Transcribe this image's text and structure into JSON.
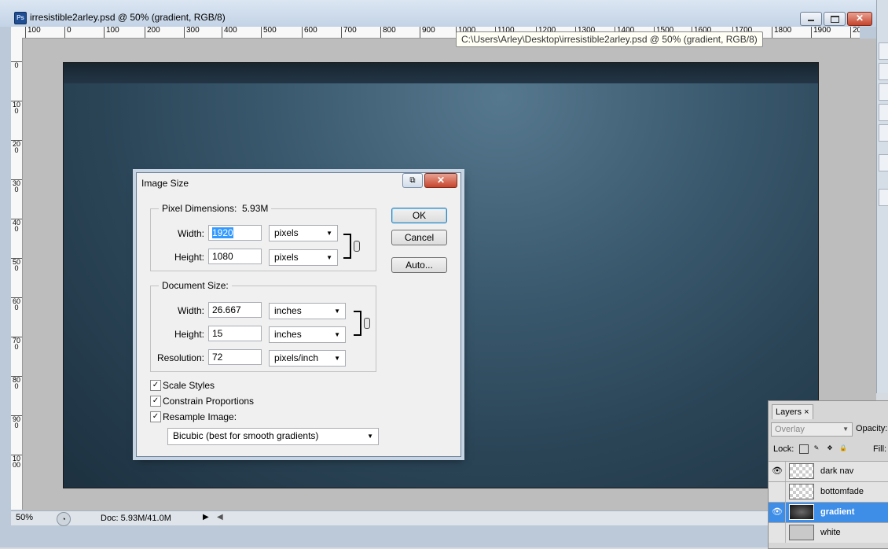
{
  "window": {
    "title": "irresistible2arley.psd @ 50% (gradient, RGB/8)",
    "app_icon_text": "Ps",
    "tooltip": "C:\\Users\\Arley\\Desktop\\irresistible2arley.psd @ 50% (gradient, RGB/8)",
    "close_glyph": "✕"
  },
  "rulers": {
    "horizontal": [
      "100",
      "0",
      "100",
      "200",
      "300",
      "400",
      "500",
      "600",
      "700",
      "800",
      "900",
      "1000",
      "1100",
      "1200",
      "1300",
      "1400",
      "1500",
      "1600",
      "1700",
      "1800",
      "1900",
      "20"
    ],
    "vertical": [
      "0",
      "100",
      "200",
      "300",
      "400",
      "500",
      "600",
      "700",
      "800",
      "900",
      "1000"
    ]
  },
  "status": {
    "zoom": "50%",
    "doc": "Doc: 5.93M/41.0M",
    "arrow": "▶",
    "scroll_left": "◀"
  },
  "dialog": {
    "title": "Image Size",
    "close_glyph": "✕",
    "extra_glyph": "⧉",
    "pixel_dimensions": {
      "legend": "Pixel Dimensions:",
      "size": "5.93M",
      "width_label": "Width:",
      "width_value": "1920",
      "width_unit": "pixels",
      "height_label": "Height:",
      "height_value": "1080",
      "height_unit": "pixels"
    },
    "document_size": {
      "legend": "Document Size:",
      "width_label": "Width:",
      "width_value": "26.667",
      "width_unit": "inches",
      "height_label": "Height:",
      "height_value": "15",
      "height_unit": "inches",
      "resolution_label": "Resolution:",
      "resolution_value": "72",
      "resolution_unit": "pixels/inch"
    },
    "buttons": {
      "ok": "OK",
      "cancel": "Cancel",
      "auto": "Auto..."
    },
    "checkboxes": [
      {
        "label": "Scale Styles",
        "checked": true
      },
      {
        "label": "Constrain Proportions",
        "checked": true
      },
      {
        "label": "Resample Image:",
        "checked": true
      }
    ],
    "check_glyph": "✓",
    "resample_method": "Bicubic (best for smooth gradients)",
    "select_arrow": "▼"
  },
  "layers_panel": {
    "tab": "Layers",
    "tab_close": "×",
    "blend_mode": "Overlay",
    "opacity_label": "Opacity:",
    "lock_label": "Lock:",
    "fill_label": "Fill:",
    "eye_glyph": "👁",
    "layers": [
      {
        "name": "dark nav",
        "visible": true,
        "active": false
      },
      {
        "name": "bottomfade",
        "visible": false,
        "active": false
      },
      {
        "name": "gradient",
        "visible": true,
        "active": true
      },
      {
        "name": "white",
        "visible": false,
        "active": false
      }
    ]
  },
  "colors": {
    "accent": "#3e8ee8",
    "selection": "#3399ff",
    "close_red": "#c7442c",
    "canvas_dark": "#1d3140",
    "canvas_light": "#56788e"
  }
}
